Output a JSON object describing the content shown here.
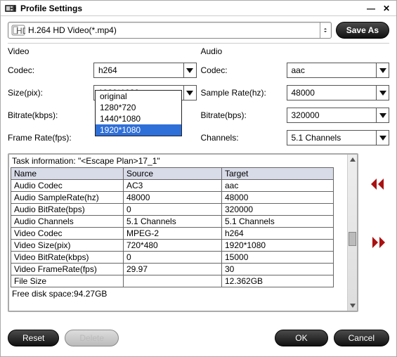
{
  "title": "Profile Settings",
  "window": {
    "minimize": "—",
    "close": "✕"
  },
  "top_select": {
    "label": "H.264 HD Video(*.mp4)"
  },
  "save_as": "Save As",
  "video": {
    "heading": "Video",
    "codec_label": "Codec:",
    "codec_value": "h264",
    "size_label": "Size(pix):",
    "size_value": "1920*1080",
    "bitrate_label": "Bitrate(kbps):",
    "bitrate_value": "",
    "fps_label": "Frame Rate(fps):",
    "fps_value": ""
  },
  "audio": {
    "heading": "Audio",
    "codec_label": "Codec:",
    "codec_value": "aac",
    "sr_label": "Sample Rate(hz):",
    "sr_value": "48000",
    "bitrate_label": "Bitrate(bps):",
    "bitrate_value": "320000",
    "ch_label": "Channels:",
    "ch_value": "5.1 Channels"
  },
  "size_options": {
    "o1": "original",
    "o2": "1280*720",
    "o3": "1440*1080",
    "o4": "1920*1080"
  },
  "task_info": "Task information: \"<Escape Plan>17_1\"",
  "table": {
    "h1": "Name",
    "h2": "Source",
    "h3": "Target",
    "rows": {
      "r1": {
        "n": "Audio Codec",
        "s": "AC3",
        "t": "aac"
      },
      "r2": {
        "n": "Audio SampleRate(hz)",
        "s": "48000",
        "t": "48000"
      },
      "r3": {
        "n": "Audio BitRate(bps)",
        "s": "0",
        "t": "320000"
      },
      "r4": {
        "n": "Audio Channels",
        "s": "5.1 Channels",
        "t": "5.1 Channels"
      },
      "r5": {
        "n": "Video Codec",
        "s": "MPEG-2",
        "t": "h264"
      },
      "r6": {
        "n": "Video Size(pix)",
        "s": "720*480",
        "t": "1920*1080"
      },
      "r7": {
        "n": "Video BitRate(kbps)",
        "s": "0",
        "t": "15000"
      },
      "r8": {
        "n": "Video FrameRate(fps)",
        "s": "29.97",
        "t": "30"
      },
      "r9": {
        "n": "File Size",
        "s": "",
        "t": "12.362GB"
      }
    }
  },
  "freedisk": "Free disk space:94.27GB",
  "buttons": {
    "reset": "Reset",
    "delete": "Delete",
    "ok": "OK",
    "cancel": "Cancel"
  }
}
